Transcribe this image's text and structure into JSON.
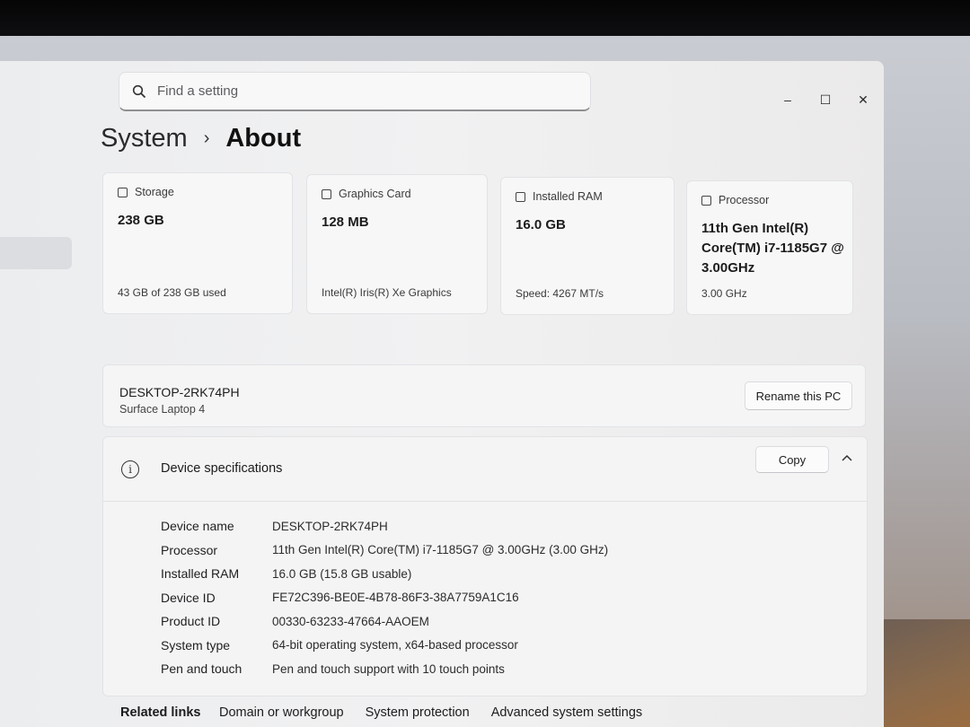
{
  "search": {
    "placeholder": "Find a setting"
  },
  "window_controls": {
    "minimize": "–",
    "maximize": "☐",
    "close": "✕"
  },
  "breadcrumb": {
    "parent": "System",
    "separator": "›",
    "current": "About"
  },
  "cards": [
    {
      "title": "Storage",
      "value": "238 GB",
      "sub": "43 GB of 238 GB used",
      "icon": "storage-icon"
    },
    {
      "title": "Graphics Card",
      "value": "128 MB",
      "sub": "Intel(R) Iris(R) Xe Graphics",
      "icon": "graphics-card-icon"
    },
    {
      "title": "Installed RAM",
      "value": "16.0 GB",
      "sub": "Speed: 4267 MT/s",
      "icon": "ram-icon"
    },
    {
      "title": "Processor",
      "value": "11th Gen Intel(R) Core(TM) i7-1185G7 @ 3.00GHz",
      "sub": "3.00 GHz",
      "icon": "processor-icon"
    }
  ],
  "pc": {
    "name": "DESKTOP-2RK74PH",
    "model": "Surface Laptop 4",
    "rename_label": "Rename this PC"
  },
  "device_specs": {
    "title": "Device specifications",
    "copy_label": "Copy",
    "expanded": true,
    "rows": [
      {
        "label": "Device name",
        "value": "DESKTOP-2RK74PH"
      },
      {
        "label": "Processor",
        "value": "11th Gen Intel(R) Core(TM) i7-1185G7 @ 3.00GHz (3.00 GHz)"
      },
      {
        "label": "Installed RAM",
        "value": "16.0 GB (15.8 GB usable)"
      },
      {
        "label": "Device ID",
        "value": "FE72C396-BE0E-4B78-86F3-38A7759A1C16"
      },
      {
        "label": "Product ID",
        "value": "00330-63233-47664-AAOEM"
      },
      {
        "label": "System type",
        "value": "64-bit operating system, x64-based processor"
      },
      {
        "label": "Pen and touch",
        "value": "Pen and touch support with 10 touch points"
      }
    ]
  },
  "related_links": {
    "title": "Related links",
    "links": [
      "Domain or workgroup",
      "System protection",
      "Advanced system settings"
    ]
  }
}
